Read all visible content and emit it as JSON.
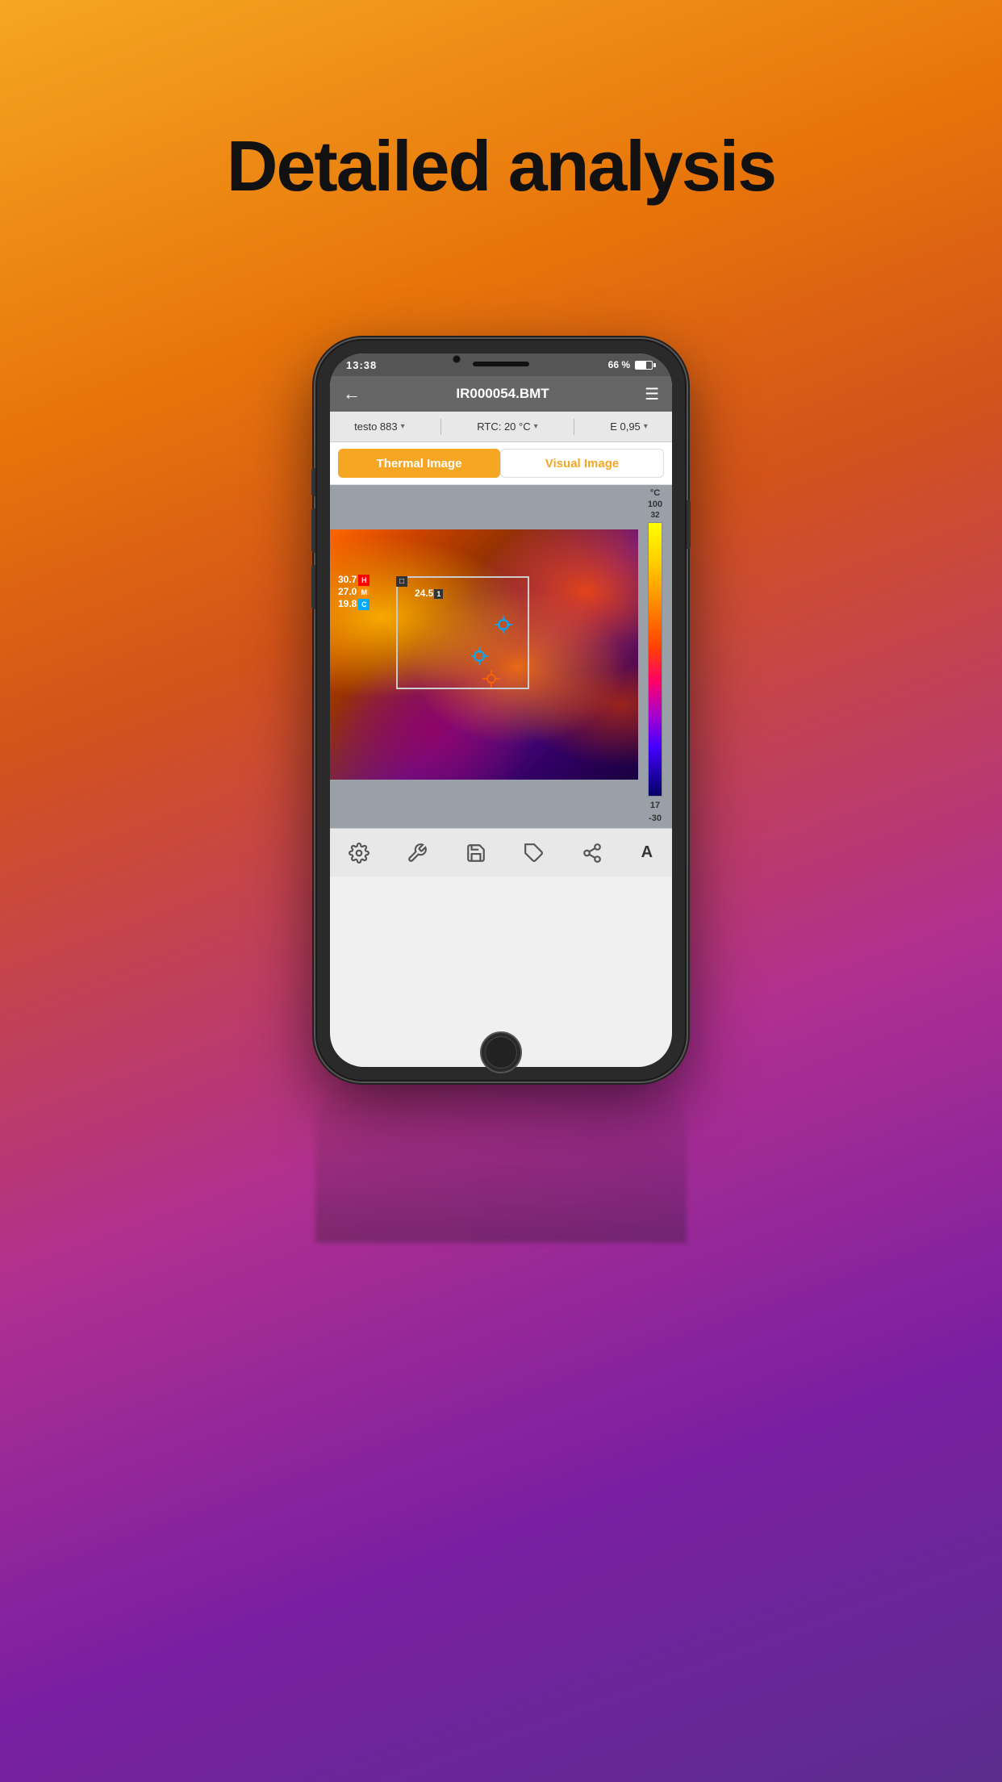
{
  "page": {
    "title": "Detailed analysis",
    "background": "linear-gradient(160deg, #f5a623, #e8760a, #c0392b, #8e44ad, #5b2d8e)"
  },
  "status_bar": {
    "time": "13:38",
    "battery_percent": "66 %"
  },
  "header": {
    "back_label": "←",
    "title": "IR000054.BMT",
    "menu_label": "☰"
  },
  "toolbar": {
    "device": "testo 883",
    "rtc": "RTC: 20 °C",
    "emissivity": "E 0,95"
  },
  "tabs": {
    "thermal_label": "Thermal Image",
    "visual_label": "Visual Image"
  },
  "scale": {
    "unit": "°C",
    "top_value": "100",
    "mid_value": "32",
    "lower_mid": "17",
    "bottom_value": "-30"
  },
  "measurements": {
    "high_label": "30.7",
    "high_badge": "H",
    "mid_label": "27.0",
    "mid_badge": "M",
    "cold_label": "19.8",
    "cold_badge": "C",
    "spot_temp": "24.5",
    "spot_badge": "1"
  },
  "bottom_toolbar": {
    "settings_icon": "⚙",
    "tools_icon": "🔧",
    "save_icon": "💾",
    "tag_icon": "🏷",
    "share_icon": "↑",
    "auto_label": "A"
  }
}
